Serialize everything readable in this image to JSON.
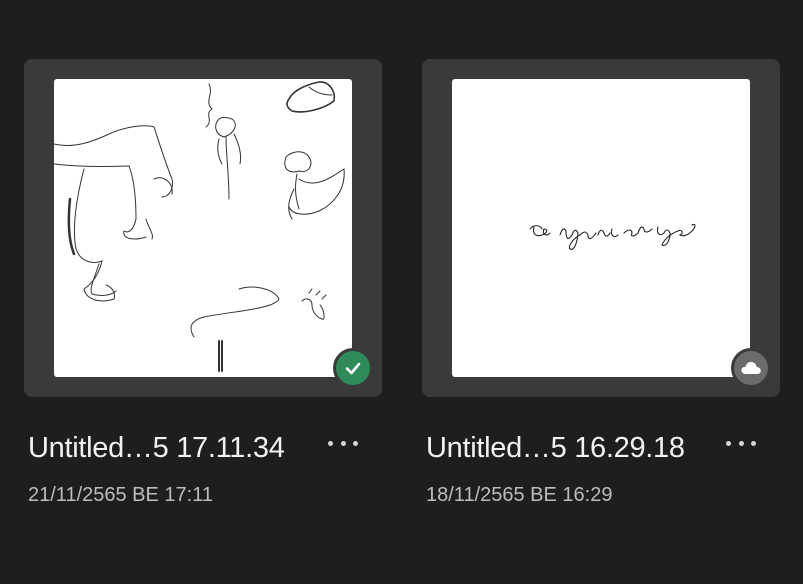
{
  "files": [
    {
      "title": "Untitled…5 17.11.34",
      "date": "21/11/2565 BE 17:11",
      "status_icon": "checkmark-synced-icon",
      "status_color": "#2e8b57"
    },
    {
      "title": "Untitled…5 16.29.18",
      "date": "18/11/2565 BE 16:29",
      "status_icon": "cloud-icon",
      "status_color": "#6b6b6b"
    }
  ],
  "colors": {
    "background": "#1e1e1e",
    "card": "#3a3a3a",
    "title_text": "#f2f2f2",
    "date_text": "#bdbdbd"
  }
}
